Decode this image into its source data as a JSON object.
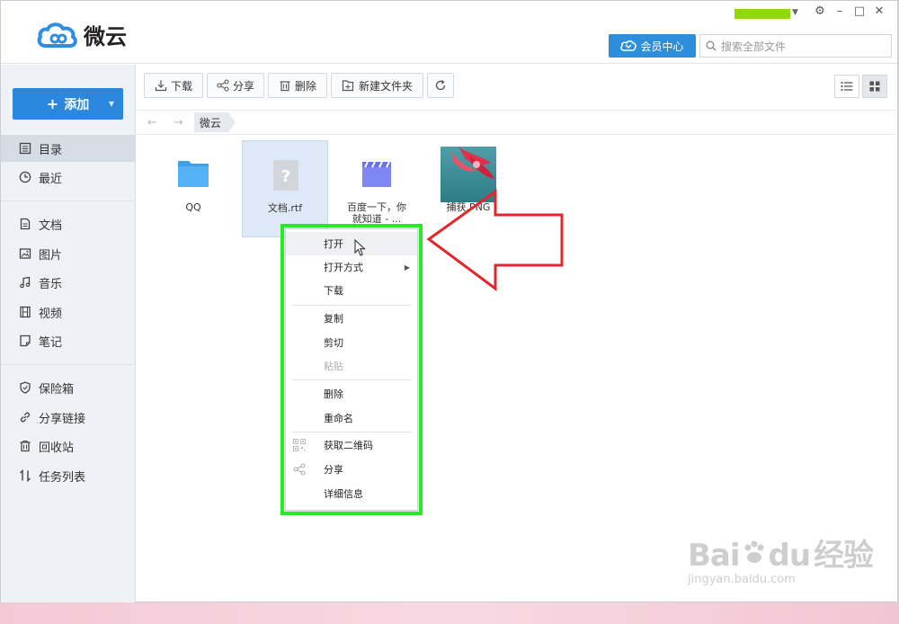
{
  "app": {
    "name": "微云",
    "colors": {
      "accent": "#2b86dd",
      "highlight": "#22ee22",
      "callout": "#e3252c"
    }
  },
  "header": {
    "vip_label": "会员中心",
    "search_placeholder": "搜索全部文件",
    "window_controls": [
      "⚙",
      "–",
      "□",
      "✕"
    ]
  },
  "sidebar": {
    "add_label": "添加",
    "items": [
      {
        "label": "目录",
        "icon": "directory-icon"
      },
      {
        "label": "最近",
        "icon": "clock-icon"
      },
      {
        "label": "文档",
        "icon": "document-icon"
      },
      {
        "label": "图片",
        "icon": "image-icon"
      },
      {
        "label": "音乐",
        "icon": "music-icon"
      },
      {
        "label": "视频",
        "icon": "video-icon"
      },
      {
        "label": "笔记",
        "icon": "note-icon"
      },
      {
        "label": "保险箱",
        "icon": "shield-icon"
      },
      {
        "label": "分享链接",
        "icon": "link-icon"
      },
      {
        "label": "回收站",
        "icon": "trash-icon"
      },
      {
        "label": "任务列表",
        "icon": "transfer-icon"
      }
    ]
  },
  "toolbar": {
    "download": "下载",
    "share": "分享",
    "delete": "删除",
    "new_folder": "新建文件夹"
  },
  "breadcrumb": {
    "current": "微云"
  },
  "files": [
    {
      "name": "QQ",
      "type": "folder"
    },
    {
      "name": "文档.rtf",
      "type": "unknown"
    },
    {
      "name_line1": "百度一下，你",
      "name_line2": "就知道 - ...",
      "type": "video"
    },
    {
      "name": "捕获.PNG",
      "type": "image"
    }
  ],
  "context_menu": {
    "items": [
      "打开",
      "打开方式",
      "下载",
      "复制",
      "剪切",
      "粘贴",
      "删除",
      "重命名",
      "获取二维码",
      "分享",
      "详细信息"
    ]
  },
  "watermark": {
    "main": "Bai",
    "main2": "du",
    "main3": "经验",
    "sub": "jingyan.baidu.com"
  }
}
